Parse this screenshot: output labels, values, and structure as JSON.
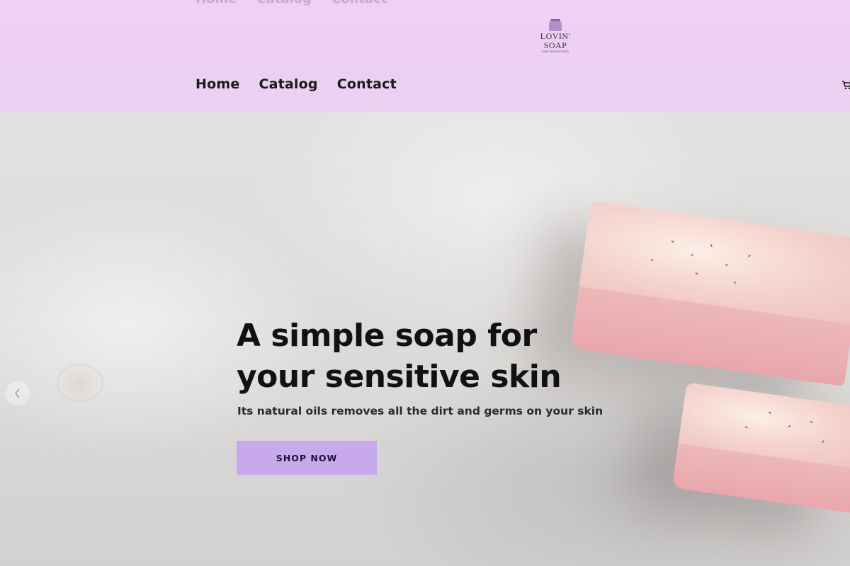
{
  "header": {
    "logo": {
      "name": "LOVIN' SOAP",
      "tagline": "soap making studio"
    },
    "nav": [
      {
        "label": "Home"
      },
      {
        "label": "Catalog"
      },
      {
        "label": "Contact"
      }
    ],
    "cart_icon": "cart-icon",
    "background_color": "#edd0f3"
  },
  "hero": {
    "title": "A simple soap for your sensitive skin",
    "subtitle": "Its natural oils removes all the dirt and germs on your skin",
    "cta_label": "SHOP NOW",
    "cta_color": "#c7a9ec",
    "prev_icon": "chevron-left-icon"
  }
}
